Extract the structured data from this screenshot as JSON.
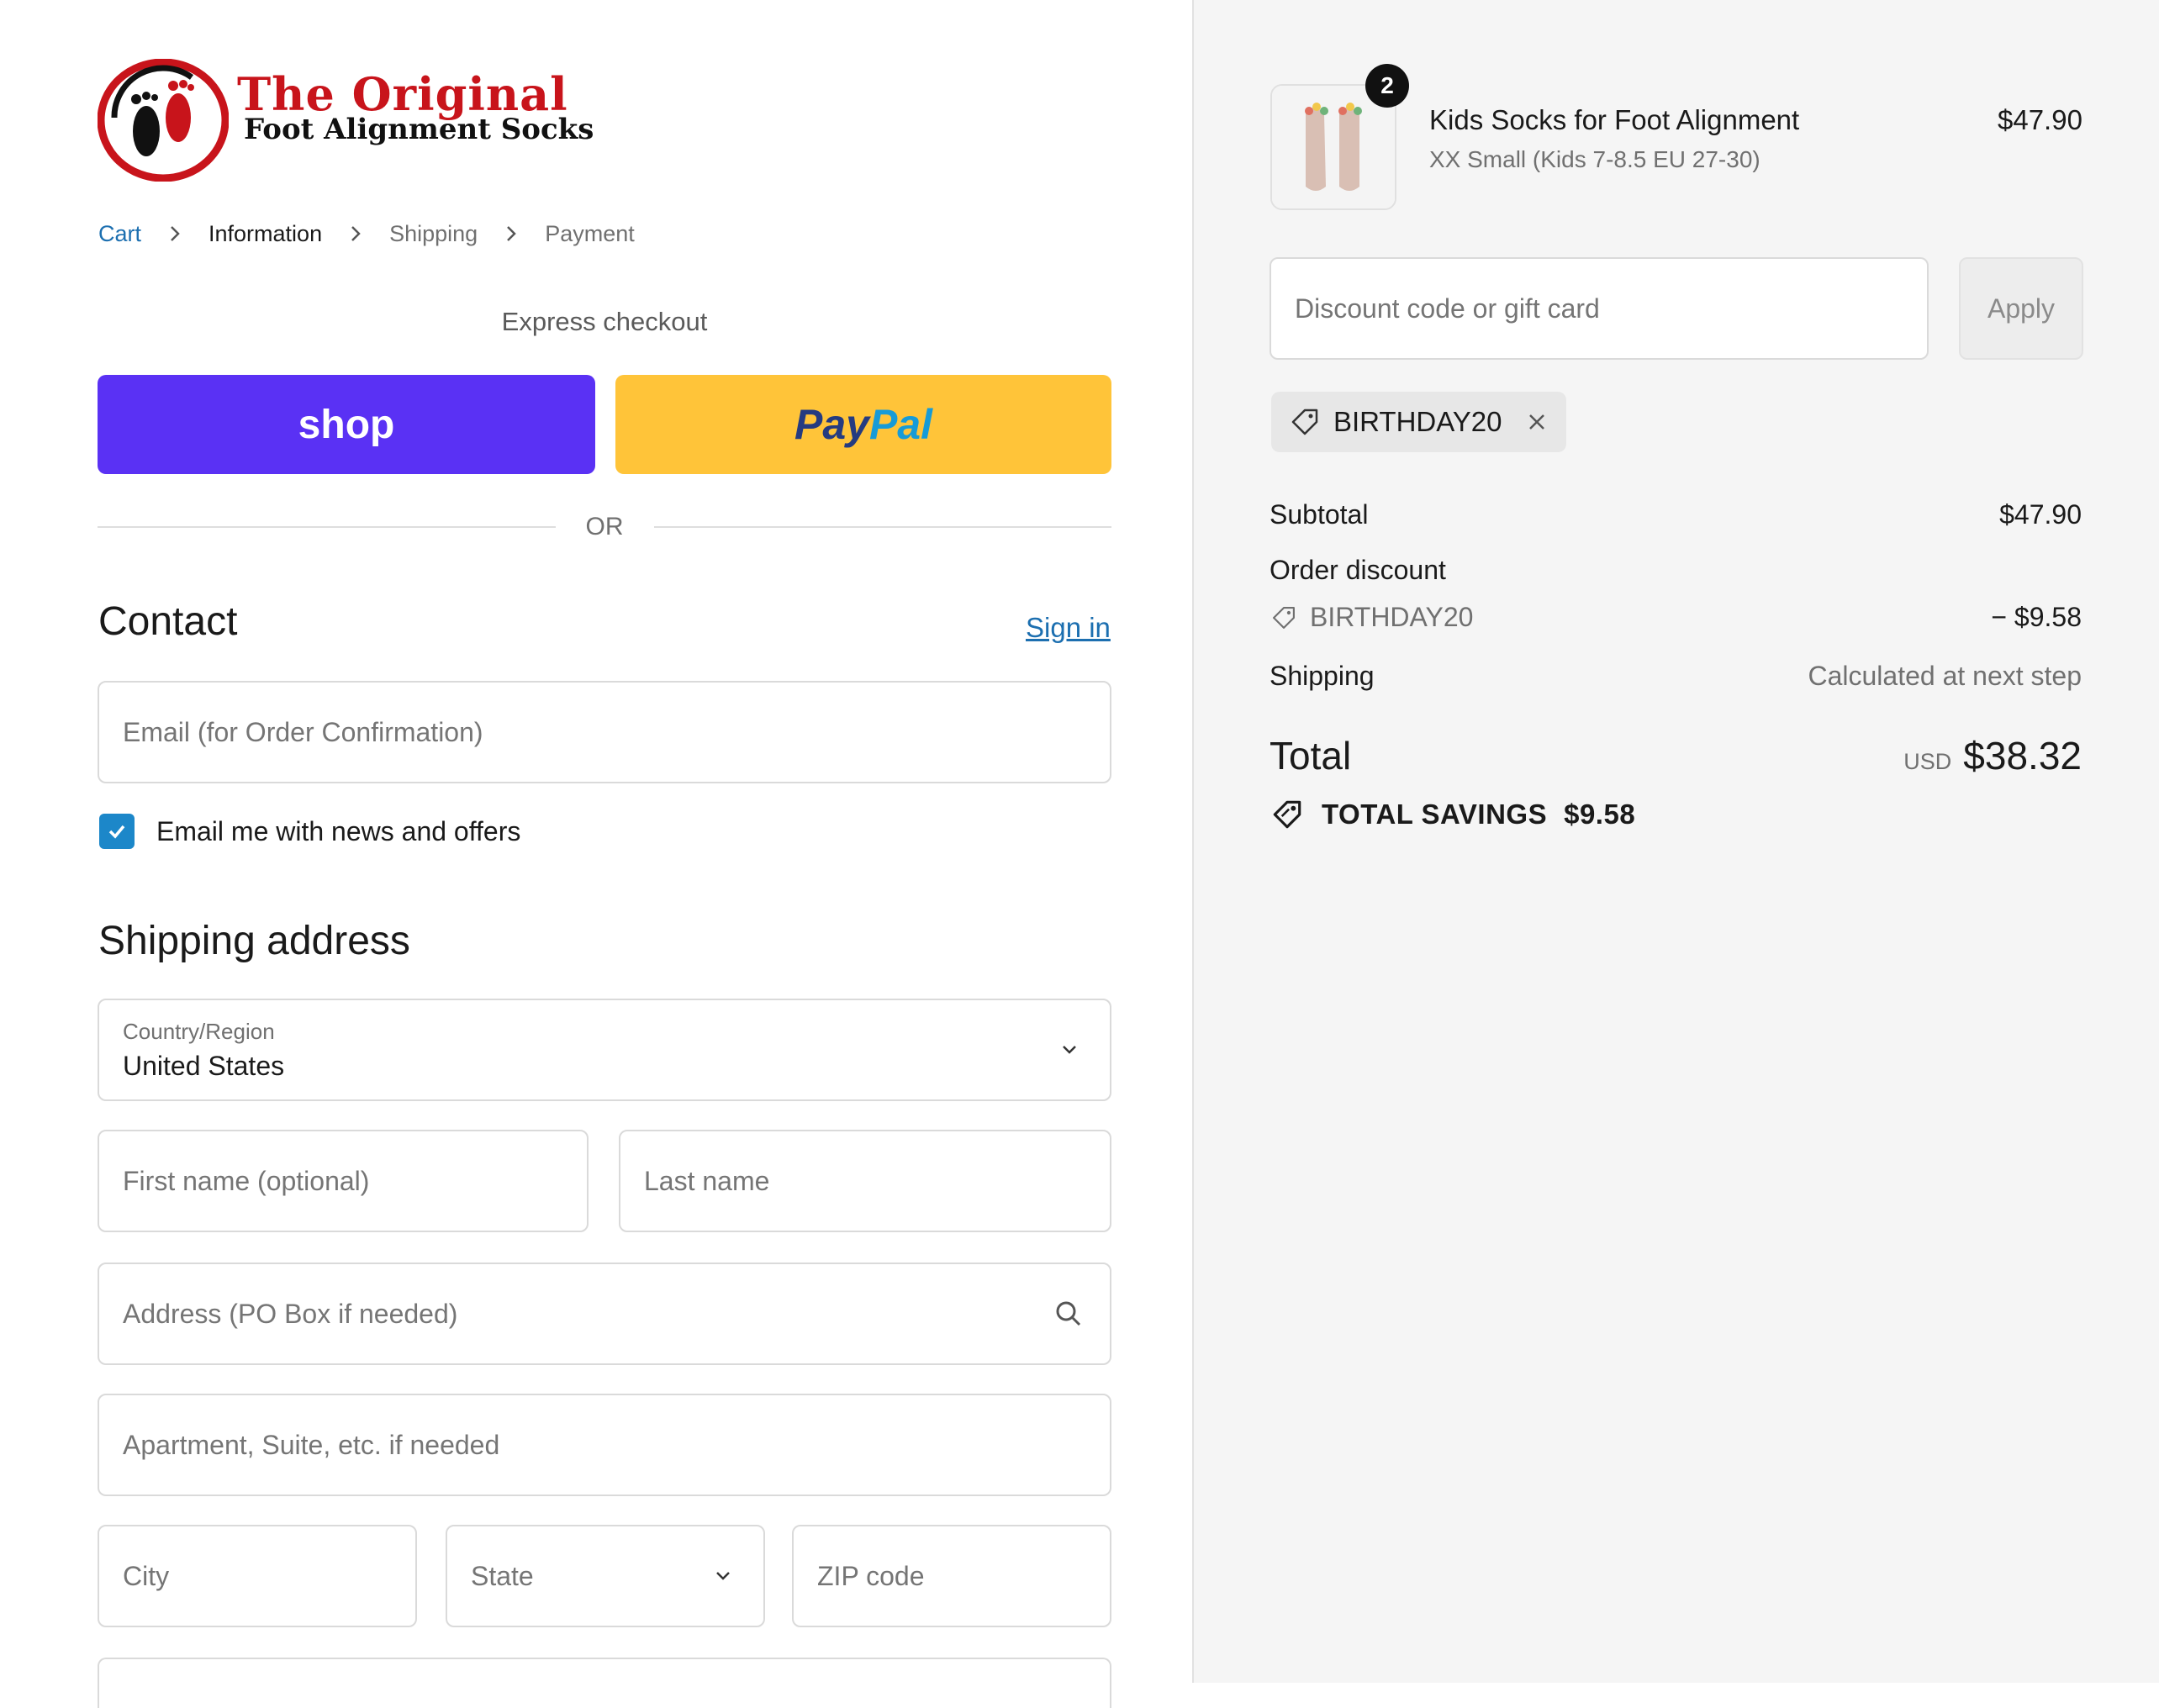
{
  "brand": {
    "name_line1": "The Original",
    "name_line2": "Foot Alignment Socks",
    "colors": {
      "red": "#c8141b",
      "shop_purple": "#5a31f4",
      "paypal_yellow": "#ffc439",
      "link_blue": "#1c6fb0"
    }
  },
  "breadcrumb": [
    {
      "label": "Cart",
      "state": "link"
    },
    {
      "label": "Information",
      "state": "current"
    },
    {
      "label": "Shipping",
      "state": "pending"
    },
    {
      "label": "Payment",
      "state": "pending"
    }
  ],
  "express": {
    "label": "Express checkout",
    "shop_label": "shop",
    "paypal_part1": "Pay",
    "paypal_part2": "Pal",
    "or_label": "OR"
  },
  "contact": {
    "heading": "Contact",
    "sign_in": "Sign in",
    "email_placeholder": "Email (for Order Confirmation)",
    "newsletter_label": "Email me with news and offers",
    "newsletter_checked": true
  },
  "shipping": {
    "heading": "Shipping address",
    "country_label": "Country/Region",
    "country_value": "United States",
    "first_name_placeholder": "First name (optional)",
    "last_name_placeholder": "Last name",
    "address_placeholder": "Address (PO Box if needed)",
    "apartment_placeholder": "Apartment, Suite, etc. if needed",
    "city_placeholder": "City",
    "state_placeholder": "State",
    "zip_placeholder": "ZIP code"
  },
  "order": {
    "item": {
      "name": "Kids Socks for Foot Alignment",
      "variant": "XX Small (Kids 7-8.5 EU 27-30)",
      "price": "$47.90",
      "quantity": "2"
    },
    "discount_placeholder": "Discount code or gift card",
    "apply_label": "Apply",
    "applied_code": "BIRTHDAY20",
    "subtotal_label": "Subtotal",
    "subtotal_value": "$47.90",
    "order_discount_label": "Order discount",
    "discount_code": "BIRTHDAY20",
    "discount_value": "− $9.58",
    "shipping_label": "Shipping",
    "shipping_value": "Calculated at next step",
    "total_label": "Total",
    "total_currency": "USD",
    "total_value": "$38.32",
    "savings_label": "TOTAL SAVINGS",
    "savings_value": "$9.58"
  }
}
